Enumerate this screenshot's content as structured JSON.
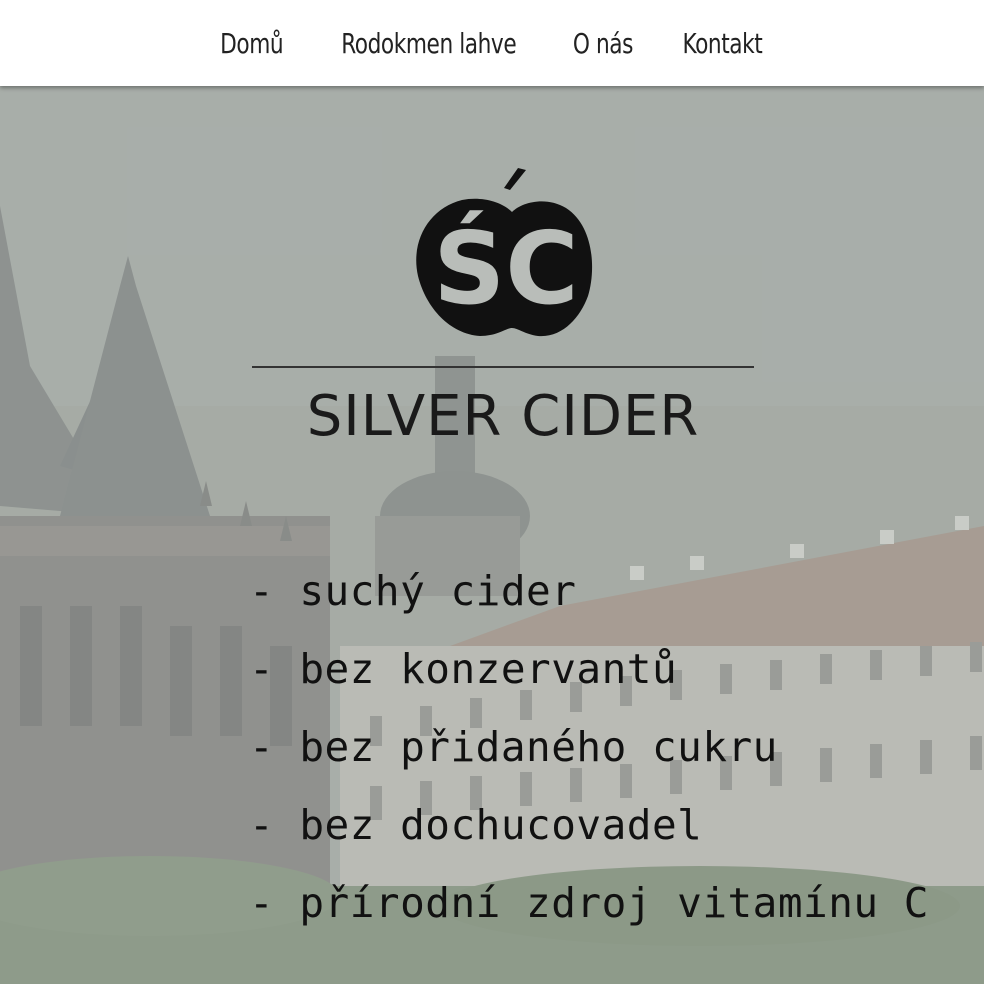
{
  "nav": {
    "items": [
      {
        "label": "Domů"
      },
      {
        "label": "Rodokmen lahve"
      },
      {
        "label": "O nás"
      },
      {
        "label": "Kontakt"
      }
    ]
  },
  "logo": {
    "monogram": "ŚC",
    "brand_name": "SILVER CIDER"
  },
  "features": [
    "- suchý cider",
    "- bez konzervantů",
    "- bez přidaného cukru",
    "- bez dochucovadel",
    "- přírodní zdroj vitamínu C"
  ],
  "colors": {
    "navbar_bg": "#ffffff",
    "nav_text": "#222222",
    "overlay": "#bec2be",
    "text_dark": "#111111"
  },
  "icons": {
    "logo_icon": "apple-monogram-icon"
  }
}
